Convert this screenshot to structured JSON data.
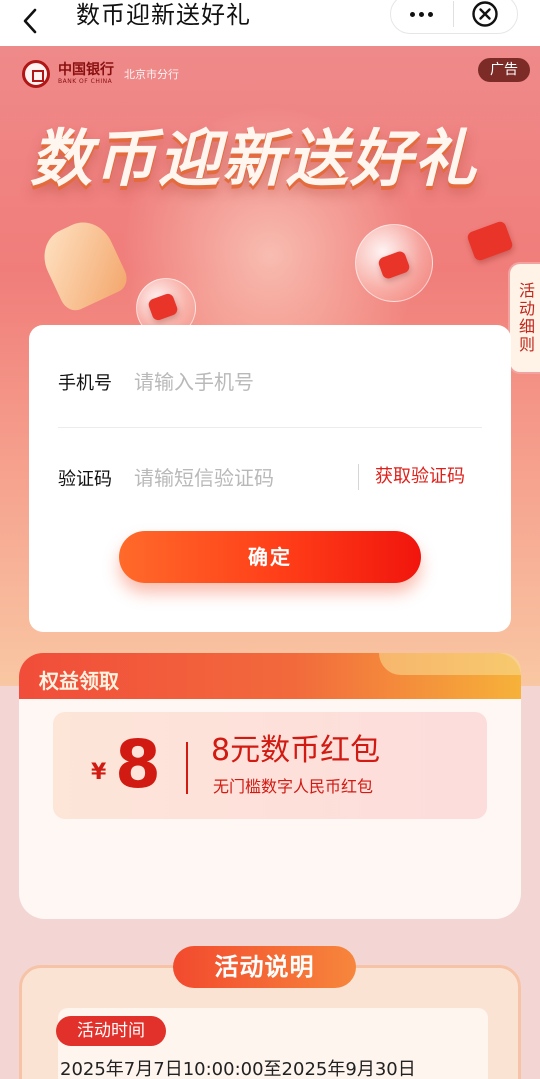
{
  "nav": {
    "title": "数币迎新送好礼"
  },
  "hero": {
    "bank_name_cn": "中国银行",
    "bank_name_en": "BANK OF CHINA",
    "branch": "北京市分行",
    "ad_tag": "广告",
    "title": "数币迎新送好礼",
    "side_tab": "活动细则"
  },
  "form": {
    "phone_label": "手机号",
    "phone_placeholder": "请输入手机号",
    "code_label": "验证码",
    "code_placeholder": "请输短信验证码",
    "get_code": "获取验证码",
    "confirm": "确定"
  },
  "benefit": {
    "title": "权益领取",
    "currency": "¥",
    "amount": "8",
    "name": "8元数币红包",
    "desc": "无门槛数字人民币红包"
  },
  "activity": {
    "title": "活动说明",
    "time_badge": "活动时间",
    "time_text": "2025年7月7日10:00:00至2025年9月30日"
  },
  "colors": {
    "accent_red": "#e0201a",
    "button_gradient_start": "#ff6a2a",
    "button_gradient_end": "#f1150d",
    "hero_bg": "#f07d7a"
  },
  "icons": [
    "back-arrow-icon",
    "more-dots-icon",
    "close-circle-icon",
    "bank-logo-icon"
  ]
}
